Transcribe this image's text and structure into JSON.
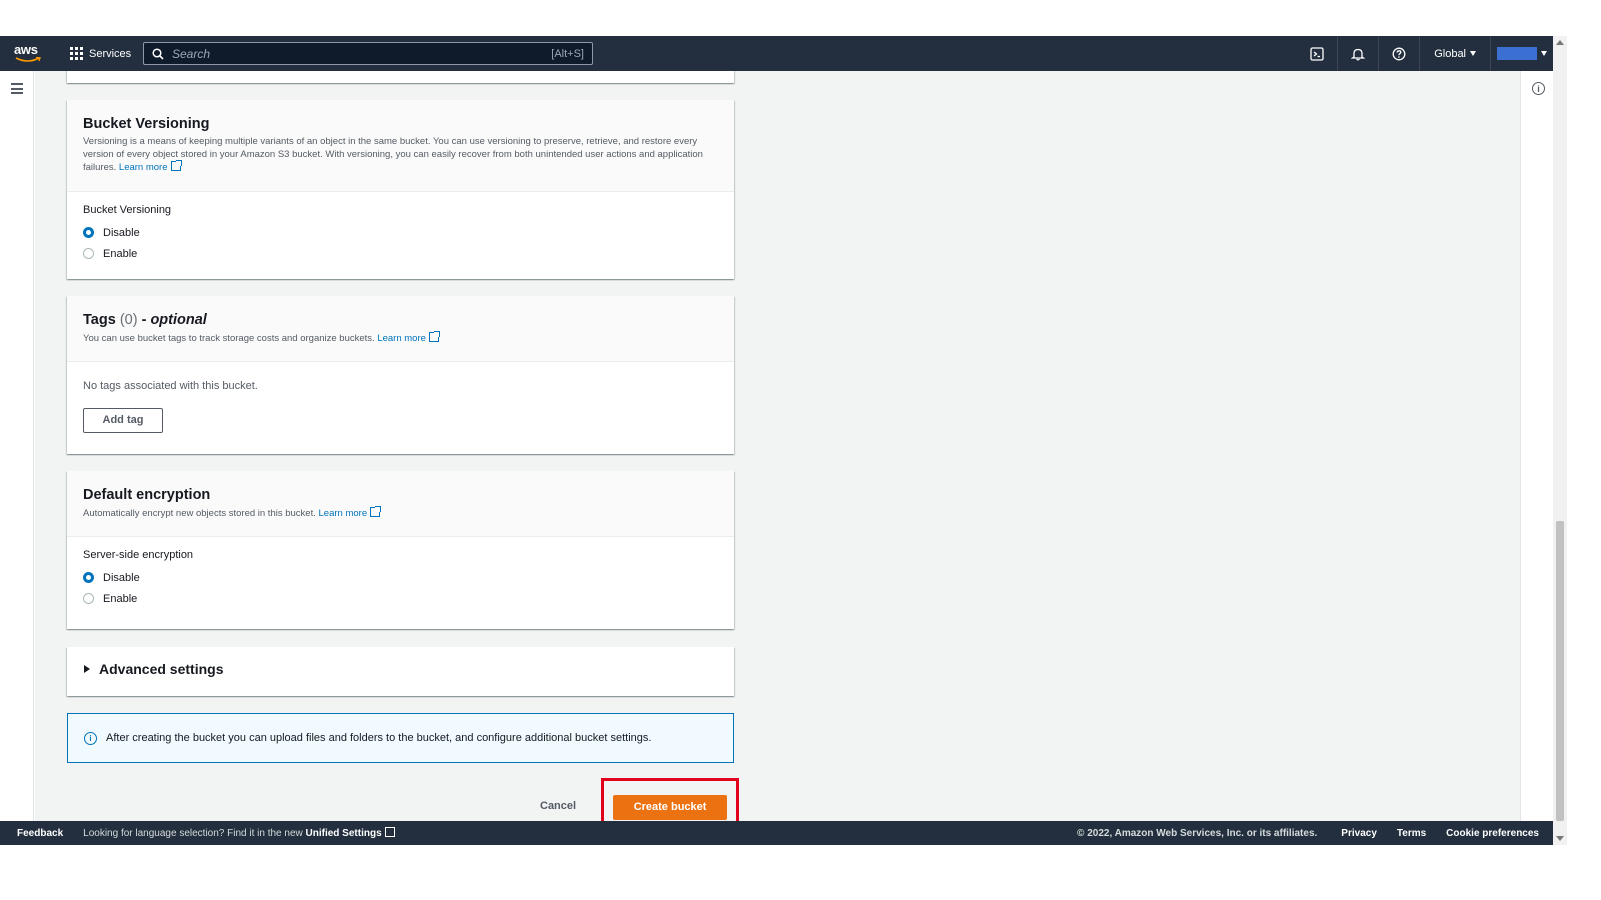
{
  "topbar": {
    "logo_text": "aws",
    "services_label": "Services",
    "search_placeholder": "Search",
    "search_shortcut": "[Alt+S]",
    "region_label": "Global"
  },
  "versioning": {
    "title": "Bucket Versioning",
    "description": "Versioning is a means of keeping multiple variants of an object in the same bucket. You can use versioning to preserve, retrieve, and restore every version of every object stored in your Amazon S3 bucket. With versioning, you can easily recover from both unintended user actions and application failures.",
    "learn_more": "Learn more",
    "field_label": "Bucket Versioning",
    "options": [
      {
        "label": "Disable",
        "checked": true
      },
      {
        "label": "Enable",
        "checked": false
      }
    ]
  },
  "tags": {
    "title": "Tags",
    "count": "(0)",
    "optional": "optional",
    "dash": "-",
    "description": "You can use bucket tags to track storage costs and organize buckets.",
    "learn_more": "Learn more",
    "empty_text": "No tags associated with this bucket.",
    "add_button": "Add tag"
  },
  "encryption": {
    "title": "Default encryption",
    "description": "Automatically encrypt new objects stored in this bucket.",
    "learn_more": "Learn more",
    "field_label": "Server-side encryption",
    "options": [
      {
        "label": "Disable",
        "checked": true
      },
      {
        "label": "Enable",
        "checked": false
      }
    ]
  },
  "advanced": {
    "label": "Advanced settings"
  },
  "alert": {
    "text": "After creating the bucket you can upload files and folders to the bucket, and configure additional bucket settings."
  },
  "actions": {
    "cancel": "Cancel",
    "create": "Create bucket",
    "highlight_color": "#e3001b",
    "primary_color": "#ec7211"
  },
  "footer": {
    "feedback": "Feedback",
    "language_note": "Looking for language selection? Find it in the new",
    "unified_settings": "Unified Settings",
    "copyright": "© 2022, Amazon Web Services, Inc. or its affiliates.",
    "privacy": "Privacy",
    "terms": "Terms",
    "cookies": "Cookie preferences"
  }
}
